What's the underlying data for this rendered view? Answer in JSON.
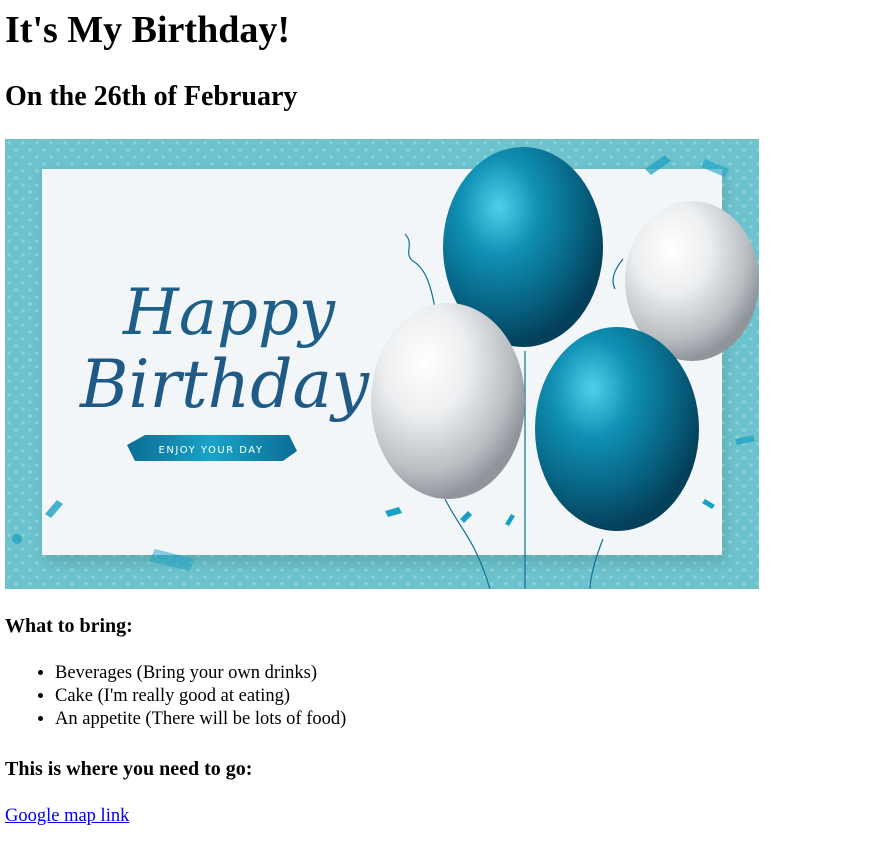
{
  "page": {
    "title": "It's My Birthday!",
    "subtitle": "On the 26th of February"
  },
  "card": {
    "line1": "Happy",
    "line2": "Birthday",
    "ribbon": "ENJOY YOUR DAY",
    "colors": {
      "frame": "#6cc3cd",
      "panel": "#f3f6f8",
      "script": "#1d5f88",
      "balloon_teal": "#0f7193",
      "balloon_silver": "#dcdfe2"
    }
  },
  "bring": {
    "heading": "What to bring:",
    "items": [
      "Beverages (Bring your own drinks)",
      "Cake (I'm really good at eating)",
      "An appetite (There will be lots of food)"
    ]
  },
  "directions": {
    "heading": "This is where you need to go:",
    "link_label": "Google map link"
  }
}
